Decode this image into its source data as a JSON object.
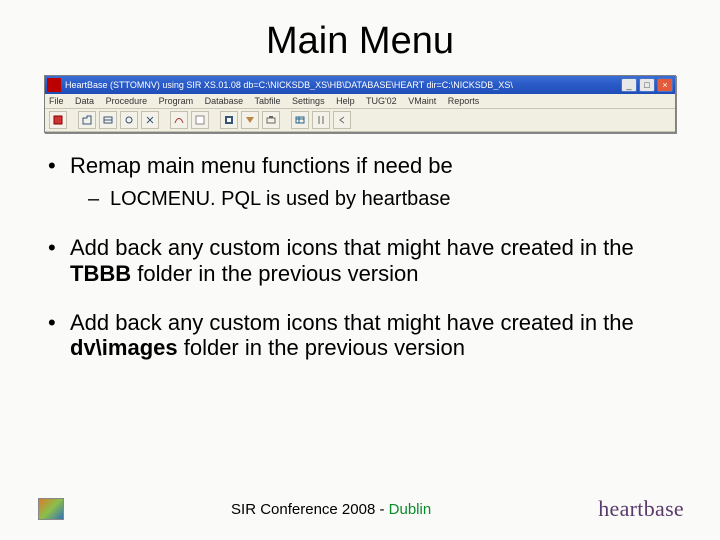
{
  "title": "Main Menu",
  "app_window": {
    "caption": "HeartBase (STTOMNV) using SIR XS.01.08 db=C:\\NICKSDB_XS\\HB\\DATABASE\\HEART dir=C:\\NICKSDB_XS\\",
    "menus": [
      "File",
      "Data",
      "Procedure",
      "Program",
      "Database",
      "Tabfile",
      "Settings",
      "Help",
      "TUG'02",
      "VMaint",
      "Reports"
    ],
    "buttons": {
      "min": "_",
      "max": "□",
      "close": "×"
    }
  },
  "bullets": {
    "b1": "Remap main menu functions if need be",
    "b1a": "LOCMENU. PQL is used by heartbase",
    "b2_pre": "Add back any custom icons that might have created in the ",
    "b2_bold": "TBBB",
    "b2_post": " folder in the previous version",
    "b3_pre": "Add back any custom icons that might have created in the ",
    "b3_bold": "dv\\images",
    "b3_post": " folder in the previous version"
  },
  "footer": {
    "conf_text": "SIR Conference 2008 - ",
    "conf_loc": "Dublin",
    "brand": "heartbase"
  }
}
